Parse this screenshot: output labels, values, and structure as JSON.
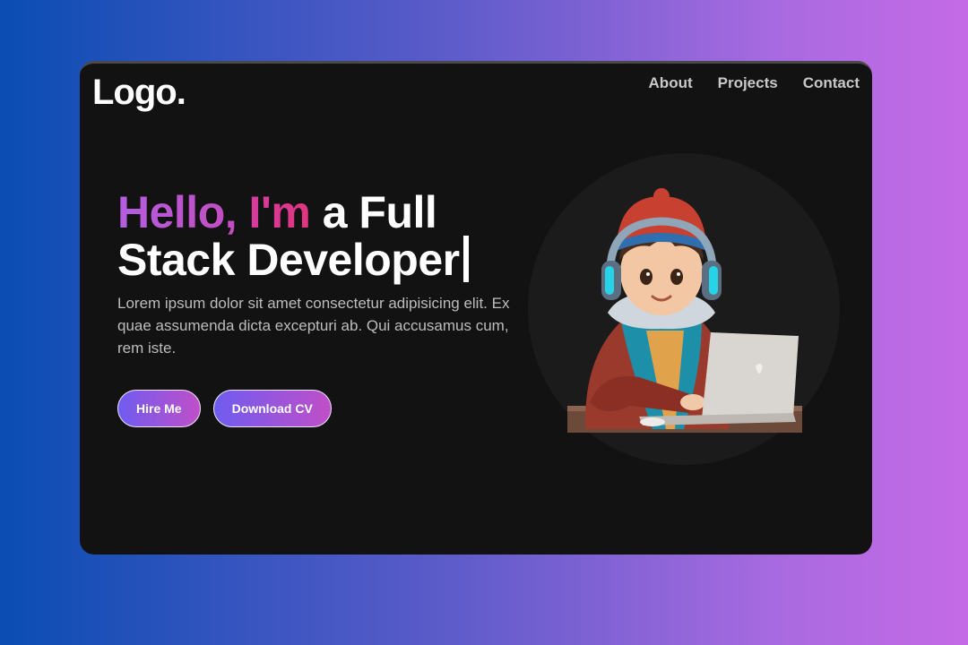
{
  "header": {
    "logo": "Logo.",
    "nav": [
      "About",
      "Projects",
      "Contact"
    ]
  },
  "hero": {
    "headline_hello": "Hello,",
    "headline_im": "I'm",
    "headline_rest_1": "a Full",
    "headline_rest_2": "Stack Developer",
    "description": "Lorem ipsum dolor sit amet consectetur adipisicing elit. Ex quae assumenda dicta excepturi ab. Qui accusamus cum, rem iste.",
    "buttons": {
      "hire": "Hire Me",
      "download": "Download CV"
    }
  },
  "colors": {
    "background_start": "#0a4db3",
    "background_end": "#c56ae6",
    "card": "#121212",
    "accent_purple": "#b35ee0",
    "accent_pink": "#e0357f"
  },
  "icons": {
    "avatar": "developer-avatar-illustration"
  }
}
